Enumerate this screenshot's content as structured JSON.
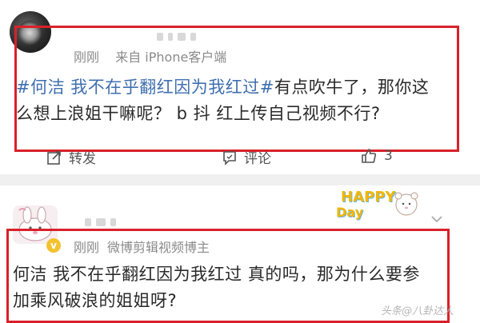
{
  "post1": {
    "time": "刚刚",
    "source": "来自 iPhone客户端",
    "hashtag": "#何洁 我不在乎翻红因为我红过#",
    "text_line1_rest": "有点吹牛了，那你这",
    "text_line2": "么想上浪姐干嘛呢？ b 抖 红上传自己视频不行?"
  },
  "actions": {
    "repost_label": "转发",
    "comment_label": "评论",
    "like_count": "3"
  },
  "post2": {
    "time": "刚刚",
    "source": "微博剪辑视频博主",
    "badge": "v",
    "text_line1": "何洁 我不在乎翻红因为我红过 真的吗，那为什么要参",
    "text_line2": "加乘风破浪的姐姐呀?"
  },
  "sticker": {
    "happy_text_1": "HAPPY",
    "happy_text_2": "Day"
  },
  "watermark": "头条@八卦达人"
}
